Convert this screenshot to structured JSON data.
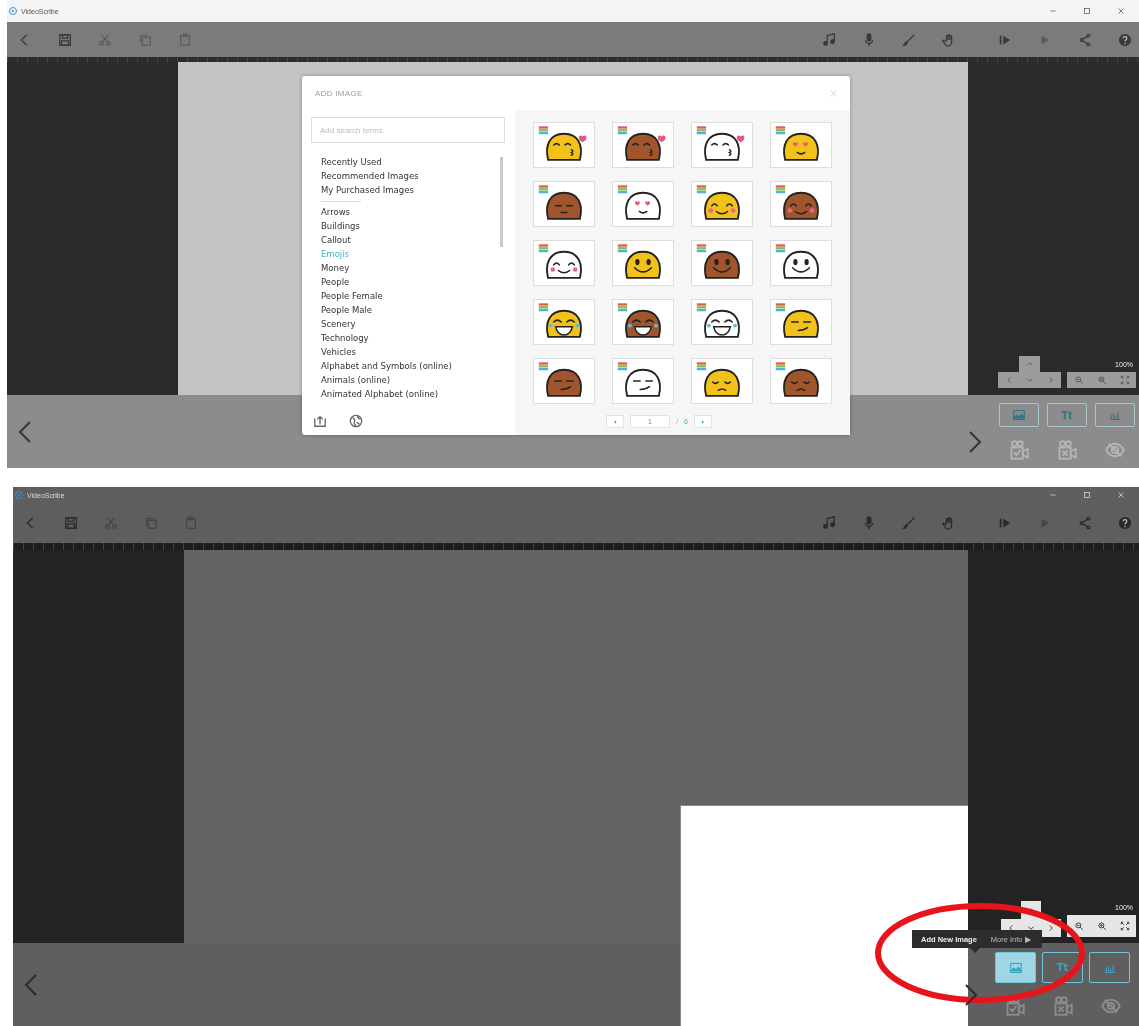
{
  "screens": [
    {
      "window": {
        "title": "VideoScribe"
      },
      "toolbar": {
        "left": [
          {
            "kind": "back",
            "disabled": false
          },
          {
            "kind": "save",
            "disabled": false
          },
          {
            "kind": "cut",
            "disabled": true
          },
          {
            "kind": "copy",
            "disabled": true
          },
          {
            "kind": "paste",
            "disabled": true
          }
        ],
        "right": [
          {
            "kind": "music",
            "disabled": false
          },
          {
            "kind": "mic",
            "disabled": false
          },
          {
            "kind": "brush",
            "disabled": false
          },
          {
            "kind": "hand",
            "disabled": false
          }
        ],
        "playback": [
          {
            "kind": "play-from",
            "disabled": false
          },
          {
            "kind": "play",
            "disabled": true
          },
          {
            "kind": "share",
            "disabled": false
          },
          {
            "kind": "help",
            "disabled": false
          }
        ]
      },
      "zoom_level": "100%",
      "tools": [
        {
          "kind": "image",
          "selected": false
        },
        {
          "kind": "text",
          "label": "Tt",
          "selected": false
        },
        {
          "kind": "chart",
          "selected": false
        }
      ],
      "scene_tools": [
        {
          "kind": "camera-check",
          "disabled": true
        },
        {
          "kind": "camera-x",
          "disabled": true
        },
        {
          "kind": "eye",
          "disabled": true
        }
      ],
      "dialog": {
        "title": "ADD IMAGE",
        "search": {
          "placeholder": "Add search terms"
        },
        "quick_links": [
          {
            "label": "Recently Used",
            "selected": false
          },
          {
            "label": "Recommended Images",
            "selected": false
          },
          {
            "label": "My Purchased Images",
            "selected": false
          }
        ],
        "categories": [
          {
            "label": "Arrows",
            "selected": false
          },
          {
            "label": "Buildings",
            "selected": false
          },
          {
            "label": "Callout",
            "selected": false
          },
          {
            "label": "Emojis",
            "selected": true
          },
          {
            "label": "Money",
            "selected": false
          },
          {
            "label": "People",
            "selected": false
          },
          {
            "label": "People Female",
            "selected": false
          },
          {
            "label": "People Male",
            "selected": false
          },
          {
            "label": "Scenery",
            "selected": false
          },
          {
            "label": "Technology",
            "selected": false
          },
          {
            "label": "Vehicles",
            "selected": false
          },
          {
            "label": "Alphabet and Symbols (online)",
            "selected": false
          },
          {
            "label": "Animals (online)",
            "selected": false
          },
          {
            "label": "Animated Alphabet (online)",
            "selected": false
          }
        ],
        "images": [
          {
            "color": "#f2c21b",
            "kind": "kiss"
          },
          {
            "color": "#a0552c",
            "kind": "kiss"
          },
          {
            "color": "#ffffff",
            "kind": "kiss"
          },
          {
            "color": "#f2c21b",
            "kind": "hearts"
          },
          {
            "color": "#a0552c",
            "kind": "sleepy"
          },
          {
            "color": "#ffffff",
            "kind": "hearts"
          },
          {
            "color": "#f2c21b",
            "kind": "blush"
          },
          {
            "color": "#a0552c",
            "kind": "blush"
          },
          {
            "color": "#ffffff",
            "kind": "blush"
          },
          {
            "color": "#f2c21b",
            "kind": "smile"
          },
          {
            "color": "#a0552c",
            "kind": "smile"
          },
          {
            "color": "#ffffff",
            "kind": "smile"
          },
          {
            "color": "#f2c21b",
            "kind": "joy"
          },
          {
            "color": "#a0552c",
            "kind": "joy"
          },
          {
            "color": "#ffffff",
            "kind": "joy"
          },
          {
            "color": "#f2c21b",
            "kind": "smirk"
          },
          {
            "color": "#a0552c",
            "kind": "smirk"
          },
          {
            "color": "#ffffff",
            "kind": "smirk"
          },
          {
            "color": "#f2c21b",
            "kind": "pensive"
          },
          {
            "color": "#a0552c",
            "kind": "pensive"
          }
        ],
        "pagination": {
          "page": "1",
          "separator": "/",
          "total": "6"
        }
      }
    },
    {
      "window": {
        "title": "VideoScribe"
      },
      "toolbar": {
        "left": [
          {
            "kind": "back",
            "disabled": false
          },
          {
            "kind": "save",
            "disabled": false
          },
          {
            "kind": "cut",
            "disabled": true
          },
          {
            "kind": "copy",
            "disabled": true
          },
          {
            "kind": "paste",
            "disabled": true
          }
        ],
        "right": [
          {
            "kind": "music",
            "disabled": false
          },
          {
            "kind": "mic",
            "disabled": false
          },
          {
            "kind": "brush",
            "disabled": false
          },
          {
            "kind": "hand",
            "disabled": false
          }
        ],
        "playback": [
          {
            "kind": "play-from",
            "disabled": false
          },
          {
            "kind": "play",
            "disabled": true
          },
          {
            "kind": "share",
            "disabled": false
          },
          {
            "kind": "help",
            "disabled": false
          }
        ]
      },
      "zoom_level": "100%",
      "tools": [
        {
          "kind": "image",
          "selected": true
        },
        {
          "kind": "text",
          "label": "Tt",
          "selected": false
        },
        {
          "kind": "chart",
          "selected": false
        }
      ],
      "scene_tools": [
        {
          "kind": "camera-check",
          "disabled": true
        },
        {
          "kind": "camera-x",
          "disabled": true
        },
        {
          "kind": "eye",
          "disabled": true
        }
      ],
      "placeholder_image": {
        "kind": "blank"
      },
      "tooltip": {
        "title": "Add New Image",
        "link": "More Info ▶"
      },
      "highlight": {
        "kind": "ellipse"
      }
    }
  ]
}
